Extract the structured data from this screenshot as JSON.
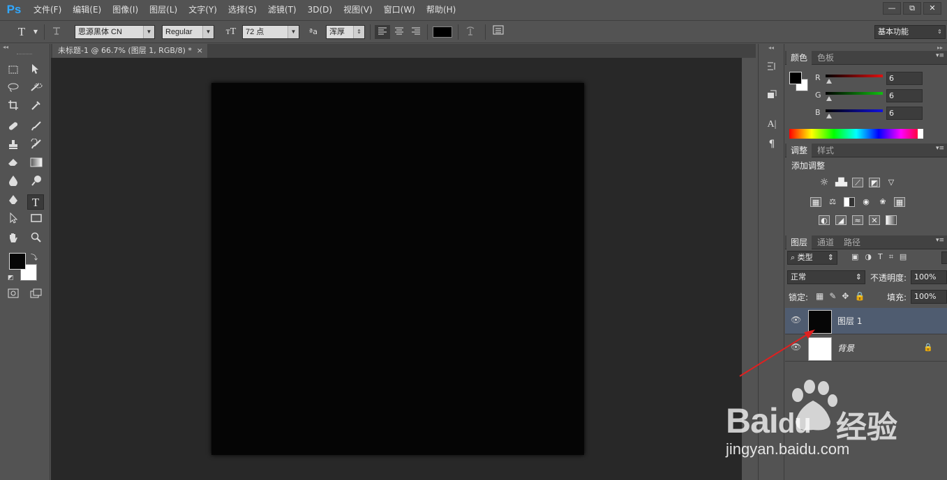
{
  "app": {
    "logo": "Ps",
    "menu": [
      "文件(F)",
      "编辑(E)",
      "图像(I)",
      "图层(L)",
      "文字(Y)",
      "选择(S)",
      "滤镜(T)",
      "3D(D)",
      "视图(V)",
      "窗口(W)",
      "帮助(H)"
    ],
    "window_buttons": [
      "—",
      "⧉",
      "✕"
    ]
  },
  "options": {
    "tool_icon": "T",
    "font_family": "思源黑体 CN",
    "font_style": "Regular",
    "font_size": "72 点",
    "aa_icon": "ªa",
    "anti_alias": "浑厚",
    "workspace": "基本功能",
    "color_swatch": "#000000"
  },
  "document": {
    "tab_title": "未标题-1 @ 66.7% (图层 1, RGB/8) *",
    "close": "×"
  },
  "color_panel": {
    "tabs": [
      "颜色",
      "色板"
    ],
    "channels": [
      {
        "label": "R",
        "value": "6",
        "color": "#e01010"
      },
      {
        "label": "G",
        "value": "6",
        "color": "#10c010"
      },
      {
        "label": "B",
        "value": "6",
        "color": "#1010e0"
      }
    ],
    "foreground": "#060606",
    "background": "#ffffff"
  },
  "adjust_panel": {
    "tabs": [
      "调整",
      "样式"
    ],
    "title": "添加调整"
  },
  "layers_panel": {
    "tabs": [
      "图层",
      "通道",
      "路径"
    ],
    "filter": "类型",
    "blend_mode": "正常",
    "opacity_label": "不透明度:",
    "opacity": "100%",
    "lock_label": "锁定:",
    "fill_label": "填充:",
    "fill": "100%",
    "layers": [
      {
        "name": "图层 1",
        "selected": true,
        "color": "#060606"
      },
      {
        "name": "背景",
        "selected": false,
        "color": "#ffffff"
      }
    ]
  },
  "watermark": {
    "brand": "Bai",
    "brand2": "du",
    "cn": "经验",
    "url": "jingyan.baidu.com"
  }
}
